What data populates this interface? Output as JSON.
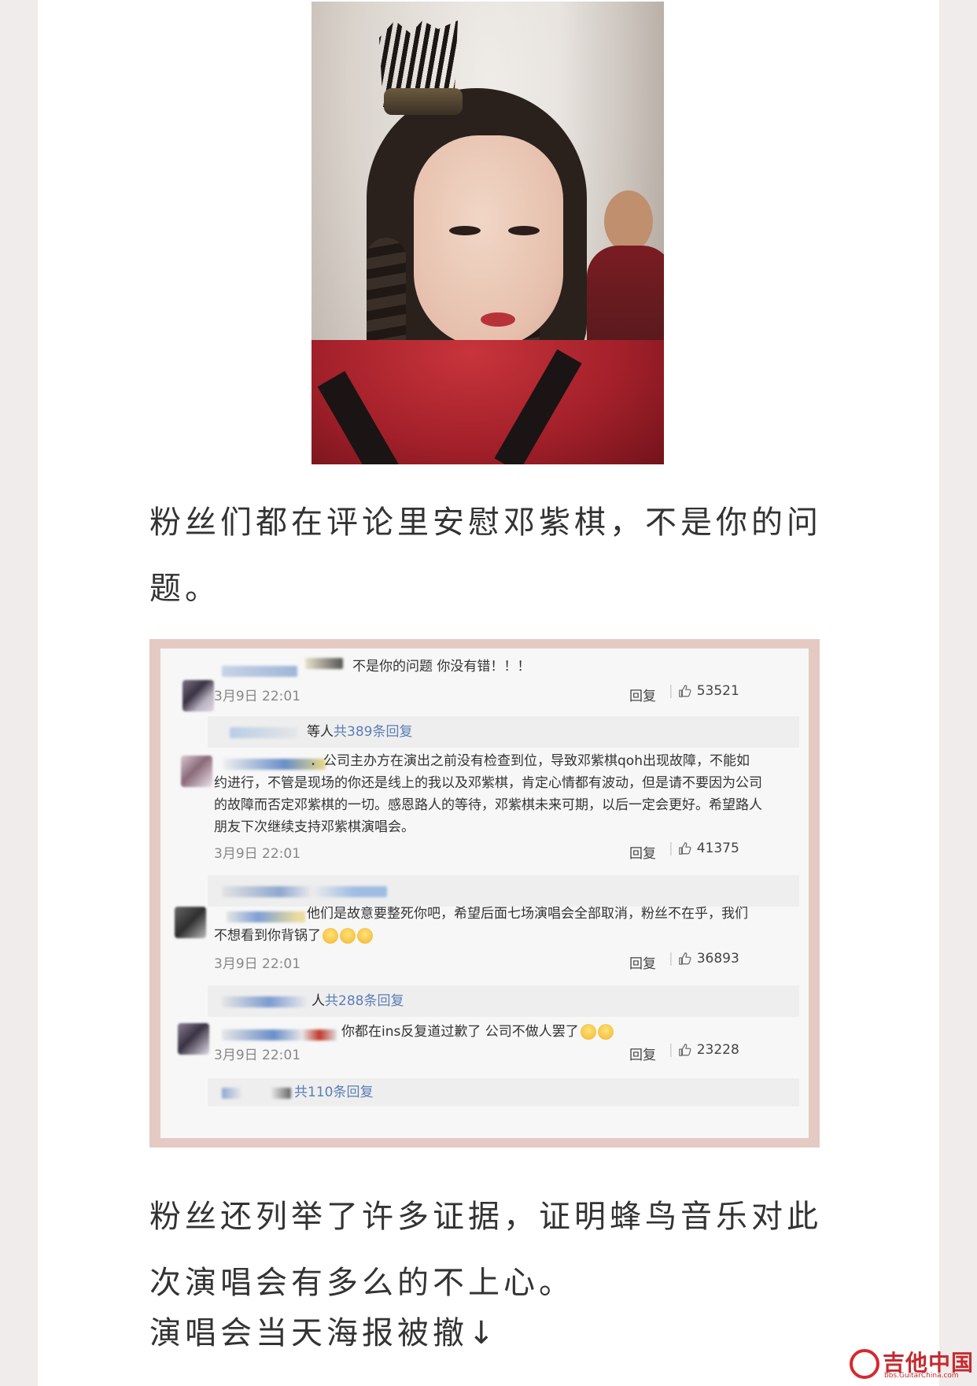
{
  "article": {
    "para1": "粉丝们都在评论里安慰邓紫棋，不是你的问题。",
    "para2": "粉丝还列举了许多证据，证明蜂鸟音乐对此次演唱会有多么的不上心。",
    "para3": "演唱会当天海报被撤↓"
  },
  "comments": [
    {
      "text": "不是你的问题 你没有错！！！",
      "time": "3月9日 22:01",
      "reply": "回复",
      "likes": "53521",
      "sub_prefix": "等人",
      "sub_count": "共389条回复"
    },
    {
      "lines": [
        "．公司主办方在演出之前没有检查到位，导致邓紫棋qoh出现故障，不能如",
        "约进行，不管是现场的你还是线上的我以及邓紫棋，肯定心情都有波动，但是请不要因为公司",
        "的故障而否定邓紫棋的一切。感恩路人的等待，邓紫棋未来可期，以后一定会更好。希望路人",
        "朋友下次继续支持邓紫棋演唱会。"
      ],
      "time": "3月9日 22:01",
      "reply": "回复",
      "likes": "41375"
    },
    {
      "lines": [
        "他们是故意要整死你吧，希望后面七场演唱会全部取消，粉丝不在乎，我们",
        "不想看到你背锅了"
      ],
      "time": "3月9日 22:01",
      "reply": "回复",
      "likes": "36893",
      "sub_prefix": "人",
      "sub_count": "共288条回复"
    },
    {
      "text": "你都在ins反复道过歉了 公司不做人罢了",
      "time": "3月9日 22:01",
      "reply": "回复",
      "likes": "23228",
      "sub_count": "共110条回复"
    }
  ],
  "watermark": {
    "name": "吉他中国",
    "url": "bbs.GuitarChina.com"
  },
  "icons": {
    "like": "thumbs-up-icon",
    "emoji": "crying-face-icon",
    "logo": "guitarchina-logo-icon"
  }
}
